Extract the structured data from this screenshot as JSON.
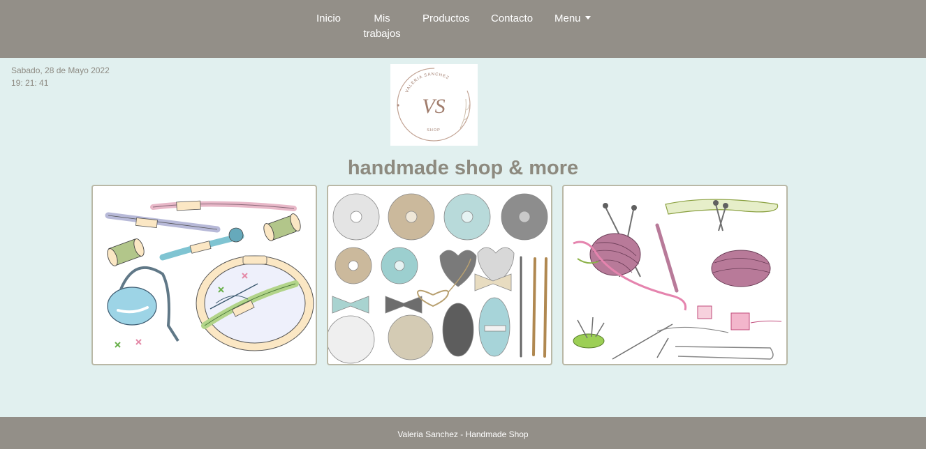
{
  "nav": {
    "items": [
      {
        "label": "Inicio"
      },
      {
        "label": "Mis trabajos"
      },
      {
        "label": "Productos"
      },
      {
        "label": "Contacto"
      },
      {
        "label": "Menu"
      }
    ]
  },
  "header": {
    "date": "Sabado, 28 de Mayo 2022",
    "time": "19: 21: 41"
  },
  "logo": {
    "monogram": "VS",
    "ring_text": "VALERIA SANCHEZ",
    "sub_text": "SHOP"
  },
  "main": {
    "headline": "handmade shop & more",
    "cards": [
      {
        "subject": "embroidery-supplies"
      },
      {
        "subject": "crochet-yarn"
      },
      {
        "subject": "knitting-supplies"
      }
    ]
  },
  "footer": {
    "text": "Valeria Sanchez - Handmade Shop"
  },
  "colors": {
    "navbar": "#938f88",
    "page_background": "#e1f0ef",
    "headline": "#8d8a7f",
    "card_border": "#b9b8a6"
  }
}
